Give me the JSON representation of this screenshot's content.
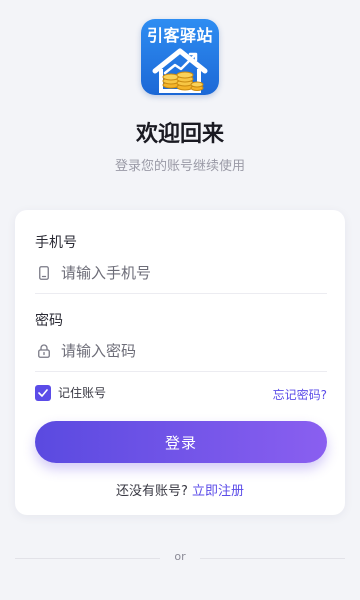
{
  "app": {
    "logo_text": "引客驿站"
  },
  "header": {
    "title": "欢迎回来",
    "subtitle": "登录您的账号继续使用"
  },
  "form": {
    "phone_label": "手机号",
    "phone_placeholder": "请输入手机号",
    "password_label": "密码",
    "password_placeholder": "请输入密码",
    "remember_label": "记住账号",
    "remember_checked": true,
    "forgot_link": "忘记密码?",
    "login_button": "登录",
    "no_account_text": "还没有账号? ",
    "register_link": "立即注册"
  },
  "divider": {
    "text": "or"
  },
  "colors": {
    "accent": "#5b4ce8",
    "logo_blue": "#1c68d6",
    "background": "#f3f4f8"
  }
}
